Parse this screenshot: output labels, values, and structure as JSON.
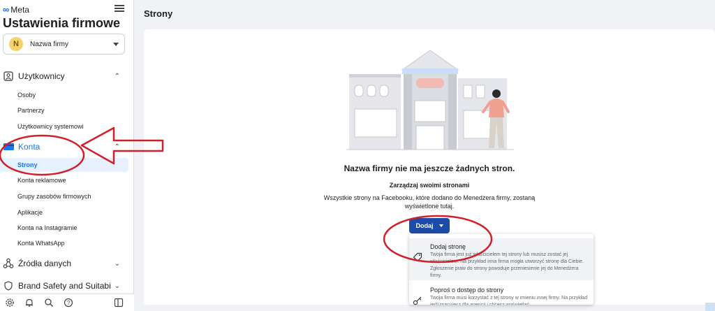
{
  "brand": {
    "logo_text": "Meta"
  },
  "sidebar": {
    "title": "Ustawienia firmowe",
    "business": {
      "initial": "N",
      "name": "Nazwa firmy"
    },
    "sections": [
      {
        "label": "Użytkownicy",
        "items": [
          "Osoby",
          "Partnerzy",
          "Użytkownicy systemowi"
        ]
      },
      {
        "label": "Konta",
        "items": [
          "Strony",
          "Konta reklamowe",
          "Grupy zasobów firmowych",
          "Aplikacje",
          "Konta na Instagramie",
          "Konta WhatsApp"
        ]
      },
      {
        "label": "Źródła danych"
      },
      {
        "label": "Brand Safety and Suitabi"
      }
    ],
    "active_item": "Strony"
  },
  "main": {
    "page_title": "Strony",
    "empty_heading": "Nazwa firmy nie ma jeszcze żadnych stron.",
    "manage_heading": "Zarządzaj swoimi stronami",
    "manage_desc": "Wszystkie strony na Facebooku, które dodano do Menedżera firmy, zostaną wyświetlone tutaj.",
    "add_button": "Dodaj",
    "dropdown": [
      {
        "title": "Dodaj stronę",
        "desc": "Twoja firma jest już właścicielem tej strony lub musisz zostać jej właścicielem. Na przykład inna firma mogła utworzyć stronę dla Ciebie. Zgłoszenie praw do strony powoduje przeniesienie jej do Menedżera firmy."
      },
      {
        "title": "Poproś o dostęp do strony",
        "desc": "Twoja firma musi korzystać z tej strony w imieniu innej firmy. Na przykład jeśli pracujesz dla agencji i chcesz wyświetlać"
      }
    ]
  },
  "colors": {
    "accent": "#1877f2",
    "button": "#1d4ca8",
    "annotation": "#d0202a"
  },
  "icons": [
    "hamburger-icon",
    "users-icon",
    "accounts-icon",
    "data-sources-icon",
    "settings-icon",
    "bell-icon",
    "search-icon",
    "help-icon",
    "panel-icon",
    "tag-icon",
    "key-icon"
  ]
}
